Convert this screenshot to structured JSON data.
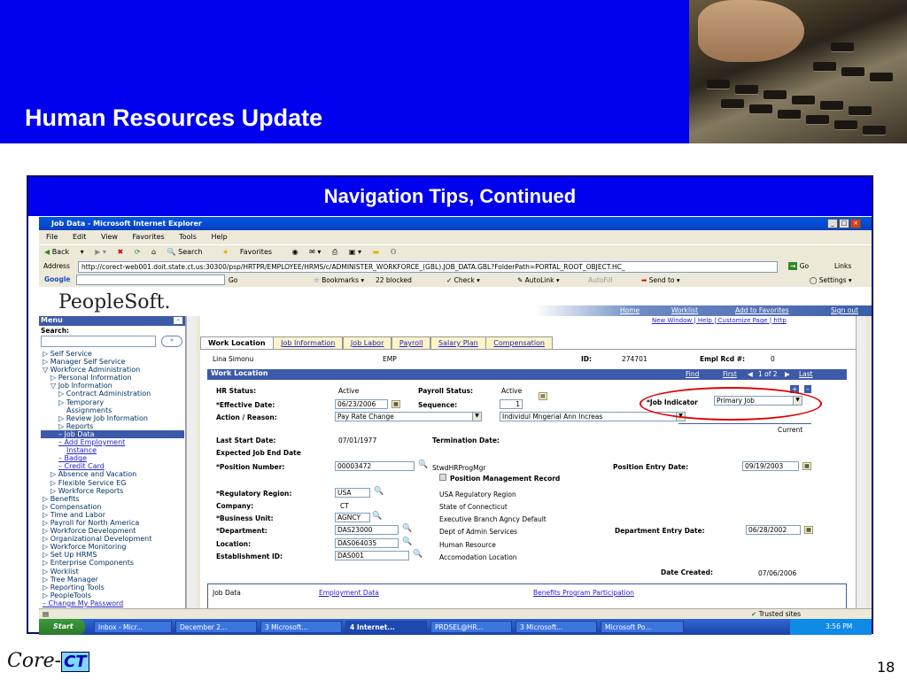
{
  "slide": {
    "title": "Human Resources Update",
    "subtitle": "Navigation Tips, Continued",
    "page_number": "18",
    "logo_text_core": "Core-",
    "logo_text_ct": "CT"
  },
  "browser": {
    "window_title": "Job Data - Microsoft Internet Explorer",
    "menus": [
      "File",
      "Edit",
      "View",
      "Favorites",
      "Tools",
      "Help"
    ],
    "toolbar": {
      "back": "Back",
      "search": "Search",
      "favorites": "Favorites"
    },
    "address_label": "Address",
    "address_value": "http://corect-web001.doit.state.ct.us:30300/psp/HRTPR/EMPLOYEE/HRMS/c/ADMINISTER_WORKFORCE_(GBL).JOB_DATA.GBL?FolderPath=PORTAL_ROOT_OBJECT.HC_",
    "go": "Go",
    "links": "Links",
    "google_bar": {
      "logo": "Google",
      "go": "Go",
      "bookmarks": "Bookmarks",
      "blocked": "22 blocked",
      "check": "Check",
      "autolink": "AutoLink",
      "autofill": "AutoFill",
      "send_to": "Send to",
      "settings": "Settings"
    }
  },
  "peoplesoft": {
    "logo": "PeopleSoft.",
    "nav_links": [
      "Home",
      "Worklist",
      "Add to Favorites",
      "Sign out"
    ],
    "sub_links": "New Window | Help | Customize Page | http"
  },
  "menu": {
    "header": "Menu",
    "search_label": "Search:",
    "go_icon": "»",
    "items": [
      {
        "text": "▷ Self Service",
        "indent": 0
      },
      {
        "text": "▷ Manager Self Service",
        "indent": 0
      },
      {
        "text": "▽ Workforce Administration",
        "indent": 0
      },
      {
        "text": "▷ Personal Information",
        "indent": 1
      },
      {
        "text": "▽ Job Information",
        "indent": 1
      },
      {
        "text": "▷ Contract Administration",
        "indent": 2
      },
      {
        "text": "▷ Temporary",
        "indent": 2
      },
      {
        "text": "Assignments",
        "indent": 3
      },
      {
        "text": "▷ Review Job Information",
        "indent": 2
      },
      {
        "text": "▷ Reports",
        "indent": 2
      },
      {
        "text": "– Job Data",
        "indent": 2,
        "selected": true
      },
      {
        "text": "– Add Employment",
        "indent": 2,
        "link": true
      },
      {
        "text": "Instance",
        "indent": 3,
        "link": true
      },
      {
        "text": "– Badge",
        "indent": 2,
        "link": true
      },
      {
        "text": "– Credit Card",
        "indent": 2,
        "link": true
      },
      {
        "text": "▷ Absence and Vacation",
        "indent": 1
      },
      {
        "text": "▷ Flexible Service EG",
        "indent": 1
      },
      {
        "text": "▷ Workforce Reports",
        "indent": 1
      },
      {
        "text": "▷ Benefits",
        "indent": 0
      },
      {
        "text": "▷ Compensation",
        "indent": 0
      },
      {
        "text": "▷ Time and Labor",
        "indent": 0
      },
      {
        "text": "▷ Payroll for North America",
        "indent": 0
      },
      {
        "text": "▷ Workforce Development",
        "indent": 0
      },
      {
        "text": "▷ Organizational Development",
        "indent": 0
      },
      {
        "text": "▷ Workforce Monitoring",
        "indent": 0
      },
      {
        "text": "▷ Set Up HRMS",
        "indent": 0
      },
      {
        "text": "▷ Enterprise Components",
        "indent": 0
      },
      {
        "text": "▷ Worklist",
        "indent": 0
      },
      {
        "text": "▷ Tree Manager",
        "indent": 0
      },
      {
        "text": "▷ Reporting Tools",
        "indent": 0
      },
      {
        "text": "▷ PeopleTools",
        "indent": 0
      },
      {
        "text": "– Change My Password",
        "indent": 0,
        "link": true
      }
    ]
  },
  "tabs": [
    "Work Location",
    "Job Information",
    "Job Labor",
    "Payroll",
    "Salary Plan",
    "Compensation"
  ],
  "employee": {
    "name": "Lina Simonu",
    "type": "EMP",
    "id_label": "ID:",
    "id": "274701",
    "rcd_label": "Empl Rcd #:",
    "rcd": "0"
  },
  "section": {
    "title": "Work Location",
    "find": "Find",
    "first": "First",
    "paging": "1 of 2",
    "last": "Last"
  },
  "form": {
    "hr_status_label": "HR Status:",
    "hr_status": "Active",
    "payroll_status_label": "Payroll Status:",
    "payroll_status": "Active",
    "effective_date_label": "*Effective Date:",
    "effective_date": "06/23/2006",
    "sequence_label": "Sequence:",
    "sequence": "1",
    "job_indicator_label": "*Job Indicator",
    "job_indicator": "Primary Job",
    "action_label": "Action / Reason:",
    "action": "Pay Rate Change",
    "reason": "Individul Mngerial Ann Increas",
    "current": "Current",
    "last_start_label": "Last Start Date:",
    "last_start": "07/01/1977",
    "termination_label": "Termination Date:",
    "expected_end_label": "Expected Job End Date",
    "position_label": "*Position Number:",
    "position": "00003472",
    "position_desc": "StwdHRProgMgr",
    "position_mgmt": "Position Management Record",
    "position_entry_label": "Position Entry Date:",
    "position_entry": "09/19/2003",
    "region_label": "*Regulatory Region:",
    "region": "USA",
    "region_desc": "USA Regulatory Region",
    "company_label": "Company:",
    "company": "CT",
    "company_desc": "State of Connecticut",
    "bu_label": "*Business Unit:",
    "bu": "AGNCY",
    "bu_desc": "Executive Branch Agncy Default",
    "dept_label": "*Department:",
    "dept": "DAS23000",
    "dept_desc": "Dept of Admin Services",
    "dept_entry_label": "Department Entry Date:",
    "dept_entry": "06/28/2002",
    "location_label": "Location:",
    "location": "DAS064035",
    "location_desc": "Human Resource",
    "estab_label": "Establishment ID:",
    "estab": "DAS001",
    "estab_desc": "Accomodation Location",
    "date_created_label": "Date Created:",
    "date_created": "07/06/2006"
  },
  "bottom_links": {
    "job_data": "Job Data",
    "employment_data": "Employment Data",
    "benefits": "Benefits Program Participation"
  },
  "status": {
    "zone": "Trusted sites"
  },
  "taskbar": {
    "start": "Start",
    "tasks": [
      "Inbox - Micr...",
      "December 2...",
      "3 Microsoft...",
      "4 Internet...",
      "PRDSEL@HR...",
      "3 Microsoft...",
      "Microsoft Po..."
    ],
    "active_index": 3,
    "time": "3:56 PM"
  }
}
